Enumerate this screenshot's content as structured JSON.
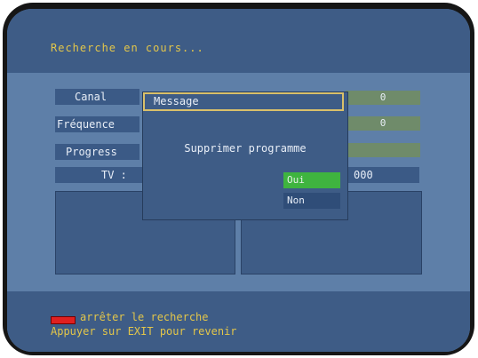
{
  "title": "Recherche en cours...",
  "fields": {
    "canal_label": "Canal",
    "canal_value": "0",
    "frequence_label": "Fréquence",
    "frequence_value": "0",
    "progress_label": "Progress",
    "tv_label": "TV :",
    "tv_value": "000"
  },
  "dialog": {
    "title": "Message",
    "message": "Supprimer programme",
    "yes": "Oui",
    "no": "Non"
  },
  "footer": {
    "stop_text": "arrêter le recherche",
    "exit_text": "Appuyer sur EXIT pour revenir"
  },
  "colors": {
    "background": "#5e7fa8",
    "band": "#3e5c86",
    "accent_text": "#e3c64a",
    "selected_button": "#3fb43f",
    "red_key": "#e02020"
  }
}
